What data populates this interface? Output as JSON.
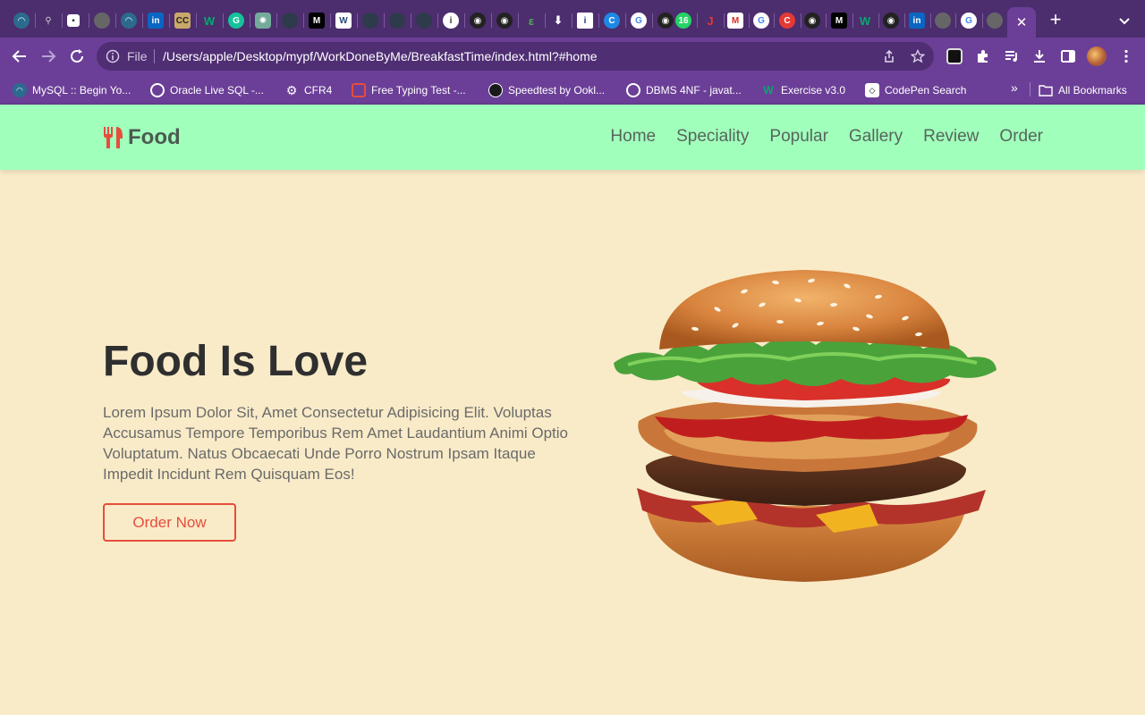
{
  "browser": {
    "active_tab_close": "✕",
    "new_tab": "+",
    "address": {
      "scheme": "File",
      "url": "/Users/apple/Desktop/mypf/WorkDoneByMe/BreakfastTime/index.html?#home"
    },
    "bookmarks": [
      {
        "label": "MySQL :: Begin Yo...",
        "icon": "mysql-icon",
        "color": "#2a6b8e"
      },
      {
        "label": "Oracle Live SQL -...",
        "icon": "globe-icon",
        "color": "#ffffff"
      },
      {
        "label": "CFR4",
        "icon": "gear-icon",
        "color": "#ffffff"
      },
      {
        "label": "Free Typing Test -...",
        "icon": "chat-icon",
        "color": "#e74c3c"
      },
      {
        "label": "Speedtest by Ookl...",
        "icon": "speedtest-icon",
        "color": "#1a1a1a"
      },
      {
        "label": "DBMS 4NF - javat...",
        "icon": "globe-icon",
        "color": "#ffffff"
      },
      {
        "label": "Exercise v3.0",
        "icon": "w3-icon",
        "color": "#04aa6d"
      },
      {
        "label": "CodePen Search",
        "icon": "codepen-icon",
        "color": "#ffffff"
      }
    ],
    "bookmarks_more": "»",
    "all_bookmarks": "All Bookmarks"
  },
  "site": {
    "logo": "Food",
    "nav": [
      "Home",
      "Speciality",
      "Popular",
      "Gallery",
      "Review",
      "Order"
    ]
  },
  "hero": {
    "title": "Food Is Love",
    "text": "Lorem Ipsum Dolor Sit, Amet Consectetur Adipisicing Elit. Voluptas Accusamus Tempore Temporibus Rem Amet Laudantium Animi Optio Voluptatum. Natus Obcaecati Unde Porro Nostrum Ipsam Itaque Impedit Incidunt Rem Quisquam Eos!",
    "button": "Order Now"
  },
  "colors": {
    "header": "#a1ffbc",
    "page": "#f9ebc8",
    "accent": "#e74c3c",
    "chrome": "#6b3f97"
  }
}
